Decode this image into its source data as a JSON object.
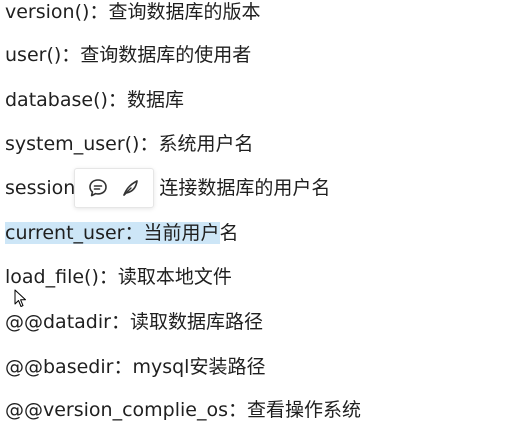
{
  "lines": [
    {
      "func": "version()",
      "sep": "：",
      "desc": "查询数据库的版本"
    },
    {
      "func": "user()",
      "sep": "：",
      "desc": "查询数据库的使用者"
    },
    {
      "func": "database()",
      "sep": "：",
      "desc": "数据库"
    },
    {
      "func": "system_user()",
      "sep": "：",
      "desc": "系统用户名"
    },
    {
      "func": "session",
      "sep": "",
      "desc": "连接数据库的用户名"
    },
    {
      "func": "current_user",
      "sep": "：",
      "desc": "当前用户",
      "rest": "名"
    },
    {
      "func": "load_file()",
      "sep": "：",
      "desc": "读取本地文件"
    },
    {
      "func": "@@datadir",
      "sep": "：",
      "desc": "读取数据库路径"
    },
    {
      "func": "@@basedir",
      "sep": "：",
      "desc": "mysql安装路径"
    },
    {
      "func": "@@version_complie_os",
      "sep": "：",
      "desc": "查看操作系统"
    }
  ],
  "popup": {
    "buttons": [
      {
        "icon": "comment-icon"
      },
      {
        "icon": "pen-icon"
      }
    ]
  },
  "colors": {
    "text": "#1f1f1f",
    "selection": "#cde6f7"
  }
}
